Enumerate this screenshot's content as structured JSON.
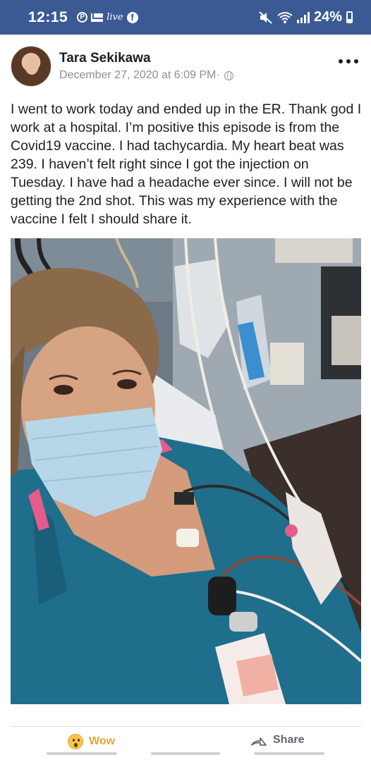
{
  "status_bar": {
    "time": "12:15",
    "battery": "24%",
    "icons": [
      "pinterest-icon",
      "mail-icon",
      "live-icon",
      "facebook-icon",
      "mute-icon",
      "wifi-icon",
      "signal-icon",
      "battery-icon"
    ]
  },
  "post": {
    "author": "Tara Sekikawa",
    "timestamp": "December 27, 2020 at 6:09 PM",
    "separator": " · ",
    "text": "I went to work today and ended up in the ER. Thank god I work at a hospital. I’m positive this episode is from the Covid19 vaccine. I had tachycardia. My heart beat was 239. I haven’t felt right since I got the injection on Tuesday. I have had a headache ever since. I will not be getting the 2nd shot. This was my experience with the vaccine I felt I should share it."
  },
  "actions": {
    "wow_label": "Wow",
    "share_label": "Share"
  },
  "colors": {
    "status_bar": "#3b5a94",
    "wow": "#e9a23a",
    "share": "#606770"
  }
}
